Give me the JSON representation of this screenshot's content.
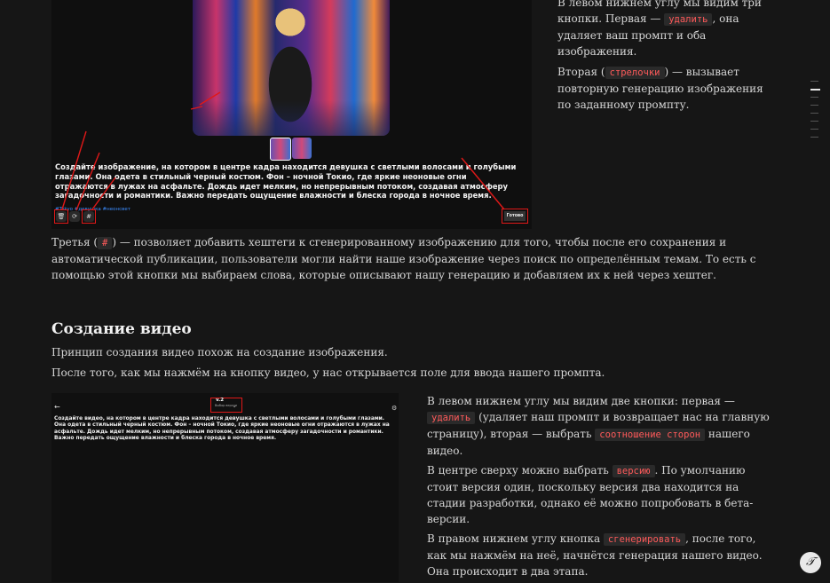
{
  "top_shot": {
    "prompt": "Создайте изображение, на котором в центре кадра находится девушка с светлыми волосами и голубыми глазами. Она одета в стильный черный костюм. Фон – ночной Токио, где яркие неоновые огни отражаются в лужах на асфальте. Дождь идет мелким, но непрерывным потоком, создавая атмосферу загадочности и романтики. Важно передать ощущение влажности и блеска города в ночное время.",
    "tags": "#Tokyo #девушка #неонсвет",
    "delete_icon": "trash-icon",
    "delete_glyph": "🗑",
    "regen_icon": "refresh-icon",
    "regen_glyph": "⟳",
    "hash_glyph": "#",
    "done_label": "Готово"
  },
  "top_right": {
    "p1_pre": "В левом нижнем углу мы видим три кнопки. Первая — ",
    "p1_code": "удалить",
    "p1_post": ", она удаляет ваш промпт и оба изображения.",
    "p2_pre": "Вторая (",
    "p2_code": "стрелочки",
    "p2_post": ") — вызывает повторную генерацию изображения по заданному промпту."
  },
  "third": {
    "pre": "Третья (",
    "code": "#",
    "post": ") — позволяет добавить хештеги к сгенерированному изображению для того, чтобы после его сохранения и автоматической публикации, пользователи могли найти наше изображение через поиск по определённым темам. То есть с помощью этой кнопки мы выбираем слова, которые описывают нашу генерацию и добавляем их к ней через хештег."
  },
  "video": {
    "heading": "Создание видео",
    "principle": "Принцип создания видео похож на создание изображения.",
    "after": "После того, как мы нажмём на кнопку видео, у нас открывается поле для ввода нашего промпта."
  },
  "video_shot": {
    "back_glyph": "←",
    "version_label": "v.2",
    "version_sub": "Выбор версии",
    "caret_glyph": "⌄",
    "settings_glyph": "⚙",
    "prompt": "Создайте видео, на котором в центре кадра находится девушка с светлыми волосами и голубыми глазами. Она одета в стильный черный костюм. Фон – ночной Токио, где яркие неоновые огни отражаются в лужах на асфальте. Дождь идет мелким, но непрерывным потоком, создавая атмосферу загадочности и романтики. Важно передать ощущение влажности и блеска города в ночное время."
  },
  "low_right": {
    "p1_pre": "В левом нижнем углу мы видим две кнопки: первая — ",
    "p1_code1": "удалить",
    "p1_mid": " (удаляет наш промпт и возвращает нас на главную страницу), вторая — выбрать ",
    "p1_code2": "соотношение сторон",
    "p1_post": " нашего видео.",
    "p2_pre": "В центре сверху можно выбрать ",
    "p2_code": "версию",
    "p2_post": ". По умолчанию стоит версия один, поскольку версия два находится на стадии разработки, однако её можно попробовать в бета-версии.",
    "p3_pre": "В правом нижнем углу кнопка ",
    "p3_code": "сгенерировать",
    "p3_post": ", после того, как мы нажмём на неё, начнётся генерация нашего видео. Она происходит в два этапа."
  },
  "corner": {
    "glyph": "𝒯",
    "icon": "typography-icon"
  },
  "colors": {
    "accent_red": "#e01818",
    "code_text": "#ff5a5a",
    "background": "#161616"
  }
}
